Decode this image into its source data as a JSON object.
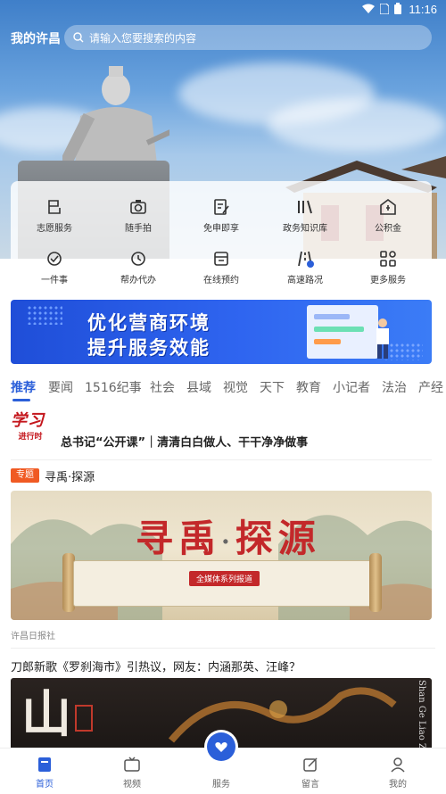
{
  "status_bar": {
    "time": "11:16"
  },
  "header": {
    "title": "我的许昌",
    "search_placeholder": "请输入您要搜索的内容"
  },
  "services": [
    {
      "label": "志愿服务",
      "icon": "volunteer-icon"
    },
    {
      "label": "随手拍",
      "icon": "camera-icon"
    },
    {
      "label": "免申即享",
      "icon": "form-edit-icon"
    },
    {
      "label": "政务知识库",
      "icon": "book-icon"
    },
    {
      "label": "公积金",
      "icon": "house-fund-icon"
    },
    {
      "label": "一件事",
      "icon": "one-thing-icon"
    },
    {
      "label": "帮办代办",
      "icon": "clock-help-icon"
    },
    {
      "label": "在线预约",
      "icon": "calendar-icon"
    },
    {
      "label": "高速路况",
      "icon": "road-icon"
    },
    {
      "label": "更多服务",
      "icon": "grid-icon"
    }
  ],
  "banner": {
    "line1": "优化营商环境",
    "line2": "提升服务效能"
  },
  "tabs": [
    "推荐",
    "要闻",
    "1516纪事",
    "社会",
    "县域",
    "视觉",
    "天下",
    "教育",
    "小记者",
    "法治",
    "产经"
  ],
  "article1": {
    "logo_big": "学习",
    "logo_small": "进行时",
    "title": "总书记“公开课”｜清清白白做人、干干净净做事"
  },
  "topic": {
    "badge": "专题",
    "name": "寻禹·探源",
    "image_title_1": "寻禹",
    "image_title_sep": "·",
    "image_title_2": "探源",
    "image_ribbon": "全媒体系列报道",
    "source": "许昌日报社"
  },
  "article2": {
    "title": "刀郎新歌《罗刹海市》引热议，网友：内涵那英、汪峰？",
    "image_calligraphy": "山",
    "image_vertical_text": "Shan Ge Liao Z"
  },
  "bottom_nav": [
    {
      "label": "首页",
      "icon": "home-icon",
      "active": true
    },
    {
      "label": "视频",
      "icon": "tv-icon",
      "active": false
    },
    {
      "label": "服务",
      "icon": "heart-hands-icon",
      "active": false
    },
    {
      "label": "留言",
      "icon": "edit-icon",
      "active": false
    },
    {
      "label": "我的",
      "icon": "user-icon",
      "active": false
    }
  ],
  "colors": {
    "accent": "#2b5fd9",
    "badge": "#f05a23",
    "logo_red": "#c4161c"
  }
}
